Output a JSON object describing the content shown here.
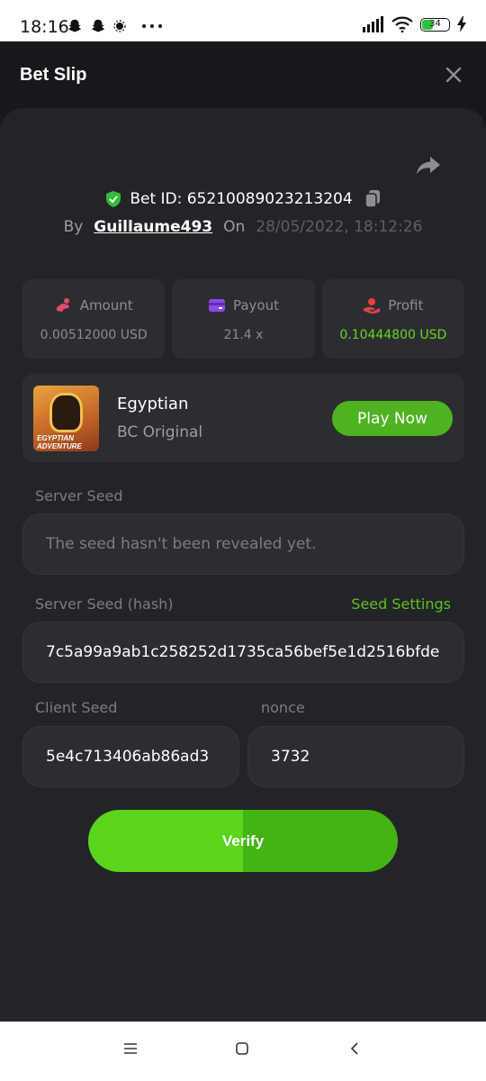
{
  "status_bar": {
    "time": "18:16",
    "battery": "34",
    "left_icons": [
      "snapchat-icon",
      "snapchat-icon",
      "dot-icon",
      "more-icon"
    ],
    "right_icons": [
      "signal-icon",
      "wifi-icon",
      "battery-icon",
      "charging-icon"
    ]
  },
  "header": {
    "title": "Bet Slip"
  },
  "bet": {
    "id_label": "Bet ID: 65210089023213204",
    "by_label": "By",
    "user": "Guillaume493",
    "on_label": "On",
    "date": "28/05/2022, 18:12:26"
  },
  "stats": [
    {
      "label": "Amount",
      "value": "0.00512000 USD"
    },
    {
      "label": "Payout",
      "value": "21.4 x"
    },
    {
      "label": "Profit",
      "value": "0.10444800 USD"
    }
  ],
  "game": {
    "name": "Egyptian",
    "provider": "BC Original",
    "thumb_caption": "EGYPTIAN ADVENTURE",
    "play_label": "Play Now"
  },
  "seeds": {
    "server_seed_label": "Server Seed",
    "server_seed_value": "The seed hasn't been revealed yet.",
    "server_hash_label": "Server Seed (hash)",
    "seed_settings_label": "Seed Settings",
    "server_hash_value": "7c5a99a9ab1c258252d1735ca56bef5e1d2516bfde",
    "client_seed_label": "Client Seed",
    "client_seed_value": "5e4c713406ab86ad3",
    "nonce_label": "nonce",
    "nonce_value": "3732"
  },
  "verify_label": "Verify",
  "colors": {
    "background": "#17181b",
    "panel": "#232428",
    "card": "#2c2d31",
    "accent_green": "#5bc21f",
    "profit_green": "#6bd424"
  }
}
